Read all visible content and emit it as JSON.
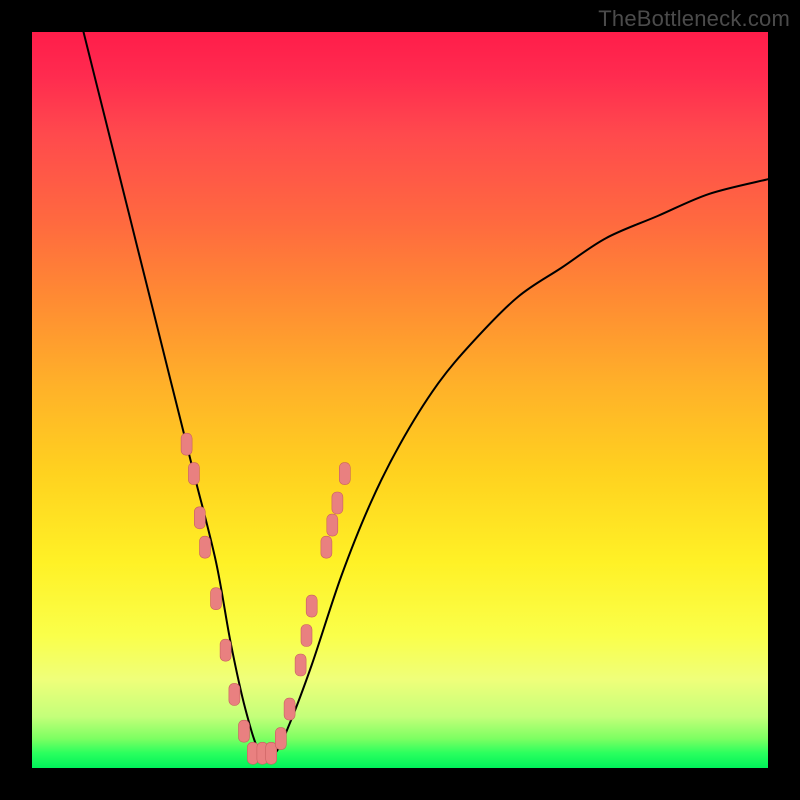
{
  "watermark": "TheBottleneck.com",
  "colors": {
    "page_bg": "#000000",
    "gradient_top": "#ff1d4a",
    "gradient_bottom": "#00f25a",
    "curve": "#000000",
    "marker_fill": "#e98080",
    "marker_stroke": "#c96060"
  },
  "chart_data": {
    "type": "line",
    "title": "",
    "xlabel": "",
    "ylabel": "",
    "xlim": [
      0,
      100
    ],
    "ylim": [
      0,
      100
    ],
    "grid": false,
    "legend": false,
    "description": "Single V-shaped curve plotted over a vertical rainbow gradient. Y is a bottleneck-like metric (high at left, drops to ~0 near x≈30, rises again toward the right). Salmon lozenge markers cluster along the lower part of both arms of the V.",
    "series": [
      {
        "name": "curve",
        "x": [
          7,
          10,
          13,
          16,
          19,
          22,
          25,
          27,
          29,
          31,
          33,
          35,
          38,
          42,
          46,
          50,
          55,
          60,
          66,
          72,
          78,
          85,
          92,
          100
        ],
        "y": [
          100,
          88,
          76,
          64,
          52,
          40,
          28,
          17,
          8,
          2,
          2,
          6,
          14,
          26,
          36,
          44,
          52,
          58,
          64,
          68,
          72,
          75,
          78,
          80
        ]
      }
    ],
    "markers": [
      {
        "x": 21.0,
        "y": 44.0
      },
      {
        "x": 22.0,
        "y": 40.0
      },
      {
        "x": 22.8,
        "y": 34.0
      },
      {
        "x": 23.5,
        "y": 30.0
      },
      {
        "x": 25.0,
        "y": 23.0
      },
      {
        "x": 26.3,
        "y": 16.0
      },
      {
        "x": 27.5,
        "y": 10.0
      },
      {
        "x": 28.8,
        "y": 5.0
      },
      {
        "x": 30.0,
        "y": 2.0
      },
      {
        "x": 31.3,
        "y": 2.0
      },
      {
        "x": 32.5,
        "y": 2.0
      },
      {
        "x": 33.8,
        "y": 4.0
      },
      {
        "x": 35.0,
        "y": 8.0
      },
      {
        "x": 36.5,
        "y": 14.0
      },
      {
        "x": 37.3,
        "y": 18.0
      },
      {
        "x": 38.0,
        "y": 22.0
      },
      {
        "x": 40.0,
        "y": 30.0
      },
      {
        "x": 40.8,
        "y": 33.0
      },
      {
        "x": 41.5,
        "y": 36.0
      },
      {
        "x": 42.5,
        "y": 40.0
      }
    ]
  }
}
